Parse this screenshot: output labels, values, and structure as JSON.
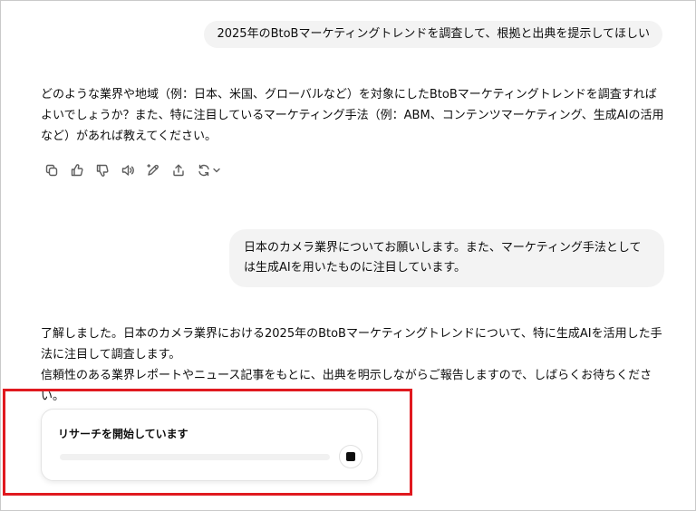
{
  "conversation": {
    "user_message_1": "2025年のBtoBマーケティングトレンドを調査して、根拠と出典を提示してほしい",
    "assistant_message_1": "どのような業界や地域（例：日本、米国、グローバルなど）を対象にしたBtoBマーケティングトレンドを調査すればよいでしょうか？また、特に注目しているマーケティング手法（例：ABM、コンテンツマーケティング、生成AIの活用など）があれば教えてください。",
    "user_message_2": "日本のカメラ業界についてお願いします。また、マーケティング手法としては生成AIを用いたものに注目しています。",
    "assistant_message_2": {
      "line_1": "了解しました。日本のカメラ業界における2025年のBtoBマーケティングトレンドについて、特に生成AIを活用した手法に注目して調査します。",
      "line_2": "信頼性のある業界レポートやニュース記事をもとに、出典を明示しながらご報告しますので、しばらくお待ちください。"
    }
  },
  "action_bar": {
    "icons": [
      "copy-icon",
      "thumbs-up-icon",
      "thumbs-down-icon",
      "read-aloud-icon",
      "edit-icon",
      "share-icon",
      "regenerate-icon",
      "chevron-down-icon"
    ]
  },
  "research_card": {
    "title": "リサーチを開始しています",
    "progress": 0
  },
  "colors": {
    "user_bubble": "#f3f3f3",
    "highlight": "#e0191f",
    "icon": "#5d5d5d",
    "text": "#0d0d0d"
  }
}
